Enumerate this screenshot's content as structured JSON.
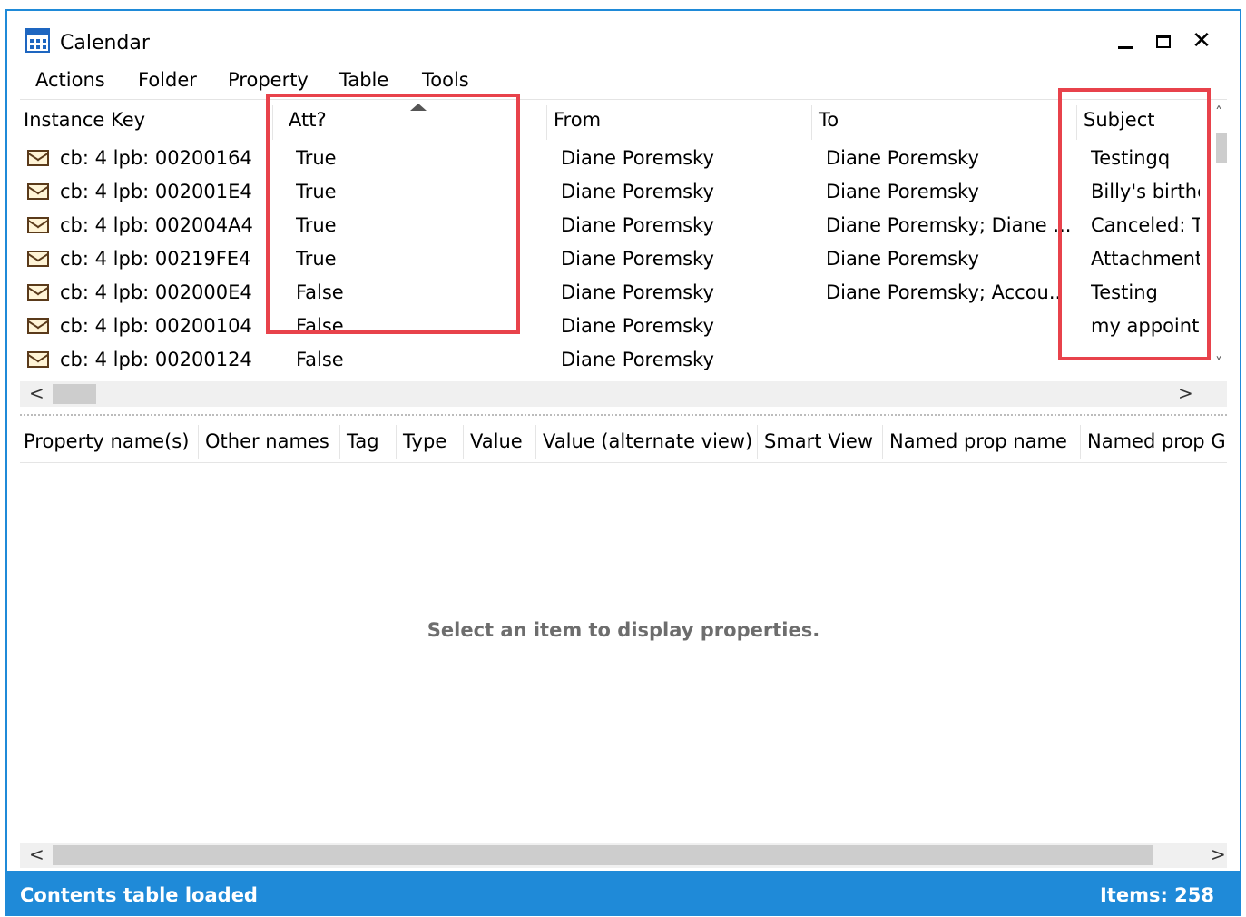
{
  "window": {
    "title": "Calendar",
    "min_glyph": "",
    "max_glyph": "",
    "close_glyph": "✕"
  },
  "menu": [
    "Actions",
    "Folder",
    "Property",
    "Table",
    "Tools"
  ],
  "list": {
    "columns": [
      "Instance Key",
      "Att?",
      "From",
      "To",
      "Subject"
    ],
    "sorted_column": "Att?",
    "rows": [
      {
        "key": "cb: 4 lpb: 00200164",
        "att": "True",
        "from": "Diane Poremsky",
        "to": "Diane Poremsky",
        "subject": "Testingq"
      },
      {
        "key": "cb: 4 lpb: 002001E4",
        "att": "True",
        "from": "Diane Poremsky",
        "to": "Diane Poremsky",
        "subject": "Billy's birthc"
      },
      {
        "key": "cb: 4 lpb: 002004A4",
        "att": "True",
        "from": "Diane Poremsky",
        "to": "Diane Poremsky; Diane ...",
        "subject": "Canceled: T"
      },
      {
        "key": "cb: 4 lpb: 00219FE4",
        "att": "True",
        "from": "Diane Poremsky",
        "to": "Diane Poremsky",
        "subject": "Attachment"
      },
      {
        "key": "cb: 4 lpb: 002000E4",
        "att": "False",
        "from": "Diane Poremsky",
        "to": "Diane Poremsky; Accou..",
        "subject": "Testing"
      },
      {
        "key": "cb: 4 lpb: 00200104",
        "att": "False",
        "from": "Diane Poremsky",
        "to": "",
        "subject": "my appoint"
      },
      {
        "key": "cb: 4 lpb: 00200124",
        "att": "False",
        "from": "Diane Poremsky",
        "to": "",
        "subject": ""
      }
    ]
  },
  "scroll": {
    "up": "˄",
    "down": "˅",
    "left": "<",
    "right": ">"
  },
  "properties": {
    "columns": [
      "Property name(s)",
      "Other names",
      "Tag",
      "Type",
      "Value",
      "Value (alternate view)",
      "Smart View",
      "Named prop name",
      "Named prop GI"
    ],
    "placeholder": "Select an item to display properties."
  },
  "status": {
    "left": "Contents table loaded",
    "right": "Items: 258"
  },
  "colors": {
    "accent": "#1f8ad8",
    "highlight": "#e8424b"
  }
}
